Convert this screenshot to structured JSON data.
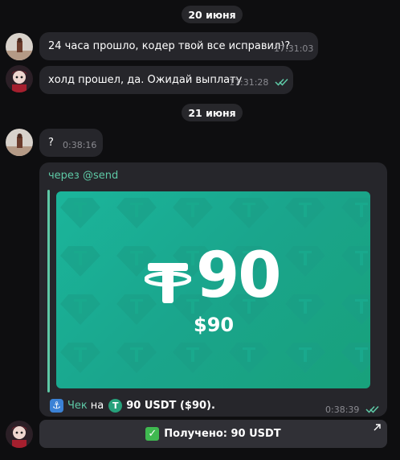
{
  "dates": {
    "d1": "20 июня",
    "d2": "21 июня"
  },
  "messages": [
    {
      "text": "24 часа прошло, кодер твой все исправил)?",
      "time": "17:31:03"
    },
    {
      "text": "холд прошел, да. Ожидай выплату",
      "time": "17:31:28"
    },
    {
      "text": "?",
      "time": "0:38:16"
    }
  ],
  "check_message": {
    "via_label": "через @send",
    "card": {
      "amount": "90",
      "usd": "$90"
    },
    "footer": {
      "link": "Чек",
      "prefix_na": "на",
      "amount_text": "90 USDT ($90)."
    },
    "time": "0:38:39"
  },
  "keyboard_button": {
    "label": "Получено: 90 USDT"
  },
  "colors": {
    "background": "#0e0e10",
    "bubble": "#26262b",
    "accent": "#5ec9a6",
    "card_green": "#1aa58c"
  },
  "icons": {
    "read_receipt": "double-check-icon",
    "external_link": "arrow-up-right-icon",
    "check_link": "anchor-icon",
    "usdt_coin": "tether-icon",
    "received": "check-mark-icon"
  }
}
